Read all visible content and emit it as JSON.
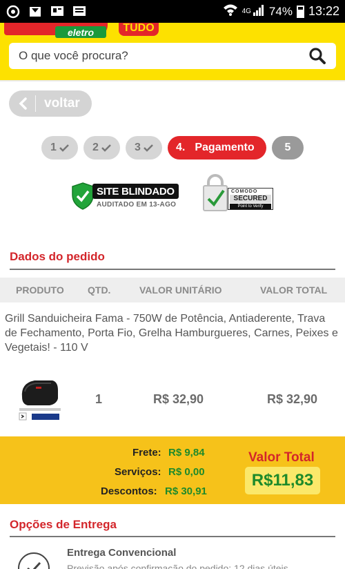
{
  "status_bar": {
    "network": "4G",
    "battery": "74%",
    "time": "13:22"
  },
  "header": {
    "logo_eletro": "eletro",
    "logo_tudo": "TUDO",
    "search_placeholder": "O que você procura?"
  },
  "back_button": {
    "label": "voltar"
  },
  "steps": [
    {
      "label": "1",
      "state": "done"
    },
    {
      "label": "2",
      "state": "done"
    },
    {
      "label": "3",
      "state": "done"
    },
    {
      "label": "4.",
      "title": "Pagamento",
      "state": "active"
    },
    {
      "label": "5",
      "state": "future"
    }
  ],
  "badges": {
    "site_blindado_title": "SITE BLINDADO",
    "site_blindado_sub": "AUDITADO EM 13-AGO",
    "comodo_name": "COMODO",
    "comodo_secured": "SECURED",
    "comodo_point": "Point to Verify"
  },
  "order": {
    "section_title": "Dados do pedido",
    "columns": [
      "PRODUTO",
      "QTD.",
      "VALOR UNITÁRIO",
      "VALOR TOTAL"
    ],
    "item": {
      "description": "Grill Sanduicheira Fama - 750W de Potência, Antiaderente, Trava de Fechamento, Porta Fio, Grelha Hamburgueres, Carnes, Peixes e Vegetais! - 110 V",
      "qty": "1",
      "unit_price": "R$ 32,90",
      "total_price": "R$ 32,90"
    }
  },
  "totals": {
    "frete_label": "Frete:",
    "frete_value": "R$ 9,84",
    "servicos_label": "Serviços:",
    "servicos_value": "R$ 0,00",
    "descontos_label": "Descontos:",
    "descontos_value": "R$ 30,91",
    "valor_total_label": "Valor Total",
    "valor_total_value": "R$11,83"
  },
  "delivery": {
    "section_title": "Opções de Entrega",
    "option_title": "Entrega Convencional",
    "option_sub": "Previsão após confirmação do pedido: 12 dias úteis"
  },
  "colors": {
    "brand_yellow": "#fde100",
    "brand_red": "#e3262a",
    "totals_bg": "#f6c21a",
    "price_green": "#1e8a2a"
  }
}
